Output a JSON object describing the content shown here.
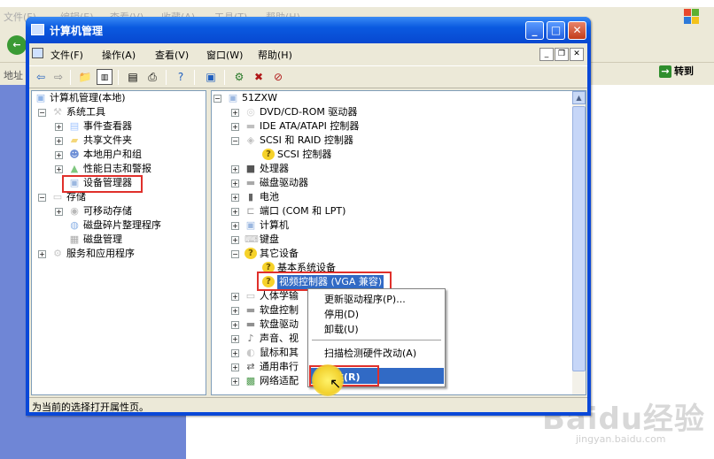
{
  "background": {
    "menu": [
      "文件(F)",
      "编辑(E)",
      "查看(V)",
      "收藏(A)",
      "工具(T)",
      "帮助(H)"
    ],
    "address_label": "地址",
    "go_label": "转到",
    "watermark": "Baidu经验",
    "watermark_sub": "jingyan.baidu.com"
  },
  "window": {
    "title": "计算机管理",
    "menu": [
      "文件(F)",
      "操作(A)",
      "查看(V)",
      "窗口(W)",
      "帮助(H)"
    ],
    "caption_buttons": {
      "minimize": "_",
      "maximize": "□",
      "close": "✕"
    }
  },
  "left_tree": [
    {
      "label": "计算机管理(本地)",
      "level": 0,
      "icon": "computer-management-icon",
      "expander": ""
    },
    {
      "label": "系统工具",
      "level": 1,
      "icon": "tools-icon",
      "expander": "−"
    },
    {
      "label": "事件查看器",
      "level": 2,
      "icon": "event-viewer-icon",
      "expander": "+"
    },
    {
      "label": "共享文件夹",
      "level": 2,
      "icon": "shared-folder-icon",
      "expander": "+"
    },
    {
      "label": "本地用户和组",
      "level": 2,
      "icon": "users-icon",
      "expander": "+"
    },
    {
      "label": "性能日志和警报",
      "level": 2,
      "icon": "performance-icon",
      "expander": "+"
    },
    {
      "label": "设备管理器",
      "level": 2,
      "icon": "device-manager-icon",
      "expander": "",
      "highlighted": true
    },
    {
      "label": "存储",
      "level": 1,
      "icon": "storage-icon",
      "expander": "−"
    },
    {
      "label": "可移动存储",
      "level": 2,
      "icon": "removable-storage-icon",
      "expander": "+"
    },
    {
      "label": "磁盘碎片整理程序",
      "level": 2,
      "icon": "defrag-icon",
      "expander": ""
    },
    {
      "label": "磁盘管理",
      "level": 2,
      "icon": "disk-management-icon",
      "expander": ""
    },
    {
      "label": "服务和应用程序",
      "level": 1,
      "icon": "services-icon",
      "expander": "+"
    }
  ],
  "right_tree": [
    {
      "label": "51ZXW",
      "level": 0,
      "icon": "computer-icon",
      "expander": "−"
    },
    {
      "label": "DVD/CD-ROM 驱动器",
      "level": 1,
      "icon": "cdrom-icon",
      "expander": "+"
    },
    {
      "label": "IDE ATA/ATAPI 控制器",
      "level": 1,
      "icon": "ide-icon",
      "expander": "+"
    },
    {
      "label": "SCSI 和 RAID 控制器",
      "level": 1,
      "icon": "scsi-icon",
      "expander": "−"
    },
    {
      "label": "SCSI 控制器",
      "level": 2,
      "icon": "warning-icon",
      "expander": ""
    },
    {
      "label": "处理器",
      "level": 1,
      "icon": "processor-icon",
      "expander": "+"
    },
    {
      "label": "磁盘驱动器",
      "level": 1,
      "icon": "disk-drive-icon",
      "expander": "+"
    },
    {
      "label": "电池",
      "level": 1,
      "icon": "battery-icon",
      "expander": "+"
    },
    {
      "label": "端口 (COM 和 LPT)",
      "level": 1,
      "icon": "port-icon",
      "expander": "+"
    },
    {
      "label": "计算机",
      "level": 1,
      "icon": "computer-icon",
      "expander": "+"
    },
    {
      "label": "键盘",
      "level": 1,
      "icon": "keyboard-icon",
      "expander": "+"
    },
    {
      "label": "其它设备",
      "level": 1,
      "icon": "unknown-device-icon",
      "expander": "−"
    },
    {
      "label": "基本系统设备",
      "level": 2,
      "icon": "warning-icon",
      "expander": ""
    },
    {
      "label": "视频控制器 (VGA 兼容)",
      "level": 2,
      "icon": "warning-icon",
      "expander": "",
      "selected": true
    },
    {
      "label": "人体学输",
      "level": 1,
      "icon": "hid-icon",
      "expander": "+"
    },
    {
      "label": "软盘控制",
      "level": 1,
      "icon": "floppy-controller-icon",
      "expander": "+"
    },
    {
      "label": "软盘驱动",
      "level": 1,
      "icon": "floppy-drive-icon",
      "expander": "+"
    },
    {
      "label": "声音、视",
      "level": 1,
      "icon": "sound-icon",
      "expander": "+"
    },
    {
      "label": "鼠标和其",
      "level": 1,
      "icon": "mouse-icon",
      "expander": "+"
    },
    {
      "label": "通用串行",
      "level": 1,
      "icon": "usb-icon",
      "expander": "+"
    },
    {
      "label": "网络适配",
      "level": 1,
      "icon": "network-icon",
      "expander": "+"
    }
  ],
  "context_menu": {
    "update_driver": "更新驱动程序(P)...",
    "disable": "停用(D)",
    "uninstall": "卸载(U)",
    "scan": "扫描检测硬件改动(A)",
    "properties": "属性(R)"
  },
  "status": "为当前的选择打开属性页。",
  "colors": {
    "title_bar": "#0a5ae0",
    "selection": "#316ac5",
    "highlight_box": "#e0302b",
    "face": "#ece9d8"
  }
}
